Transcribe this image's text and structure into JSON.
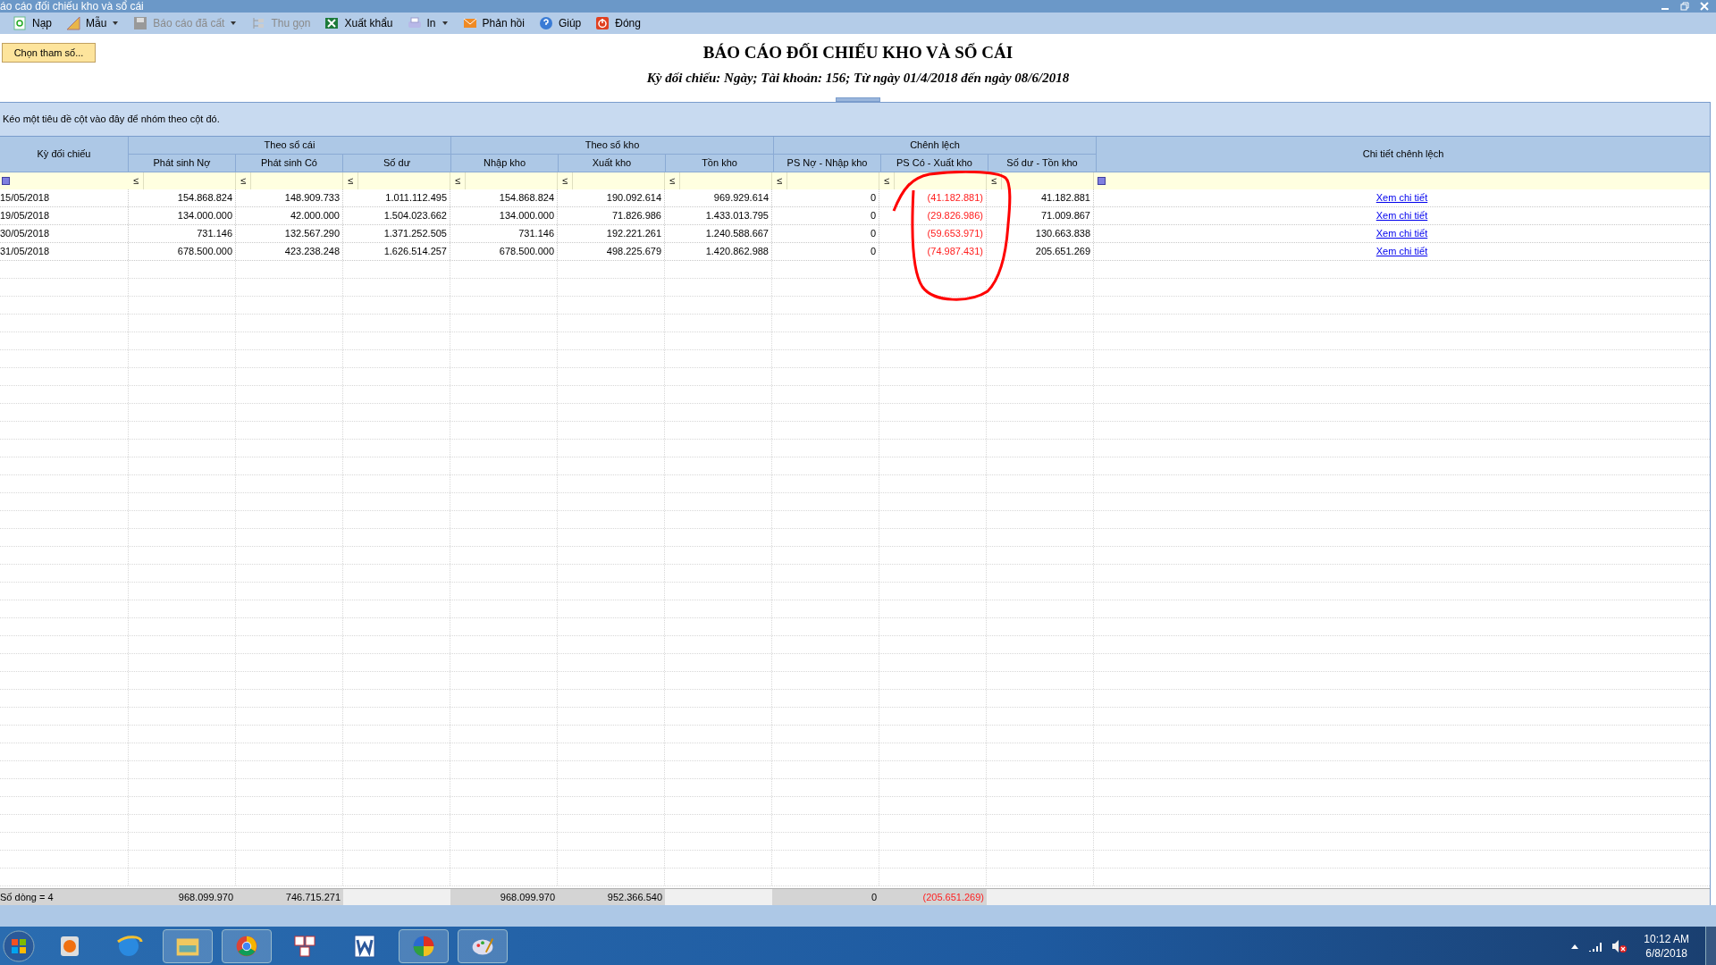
{
  "window": {
    "title": "áo cáo đối chiếu kho và sổ cái"
  },
  "toolbar": [
    {
      "label": "Nạp",
      "disabled": false,
      "dropdown": false
    },
    {
      "label": "Mẫu",
      "disabled": false,
      "dropdown": true
    },
    {
      "label": "Báo cáo đã cất",
      "disabled": true,
      "dropdown": true
    },
    {
      "label": "Thu gọn",
      "disabled": true,
      "dropdown": false
    },
    {
      "label": "Xuất khẩu",
      "disabled": false,
      "dropdown": false
    },
    {
      "label": "In",
      "disabled": false,
      "dropdown": true
    },
    {
      "label": "Phản hồi",
      "disabled": false,
      "dropdown": false
    },
    {
      "label": "Giúp",
      "disabled": false,
      "dropdown": false
    },
    {
      "label": "Đóng",
      "disabled": false,
      "dropdown": false
    }
  ],
  "parameter_button": "Chọn tham số...",
  "report": {
    "title": "BÁO CÁO ĐỐI CHIẾU KHO VÀ SỔ CÁI",
    "subtitle": "Kỳ đối chiếu: Ngày; Tài khoản: 156; Từ ngày 01/4/2018 đến ngày 08/6/2018"
  },
  "group_panel_hint": "Kéo một tiêu đề cột vào đây để nhóm theo cột đó.",
  "grid": {
    "first_column": "Kỳ đối chiếu",
    "groups": [
      {
        "label": "Theo sổ cái",
        "columns": [
          {
            "label": "Phát sinh Nợ",
            "negative": false,
            "total": "968.099.970"
          },
          {
            "label": "Phát sinh Có",
            "negative": false,
            "total": "746.715.271"
          },
          {
            "label": "Số dư",
            "negative": false
          }
        ]
      },
      {
        "label": "Theo sổ kho",
        "columns": [
          {
            "label": "Nhập kho",
            "negative": false,
            "total": "968.099.970"
          },
          {
            "label": "Xuất kho",
            "negative": false,
            "total": "952.366.540"
          },
          {
            "label": "Tồn kho",
            "negative": false
          }
        ]
      },
      {
        "label": "Chênh lệch",
        "columns": [
          {
            "label": "PS Nợ - Nhập kho",
            "negative": false,
            "total": "0"
          },
          {
            "label": "PS Có - Xuất kho",
            "negative": true,
            "total": "(205.651.269)"
          },
          {
            "label": "Số dư - Tồn kho",
            "negative": false
          }
        ]
      }
    ],
    "last_column": "Chi tiết chênh lệch",
    "filter_operator": "≤",
    "rows": [
      {
        "period": "15/05/2018",
        "values": [
          "154.868.824",
          "148.909.733",
          "1.011.112.495",
          "154.868.824",
          "190.092.614",
          "969.929.614",
          "0",
          "(41.182.881)",
          "41.182.881"
        ],
        "link": "Xem chi tiết"
      },
      {
        "period": "19/05/2018",
        "values": [
          "134.000.000",
          "42.000.000",
          "1.504.023.662",
          "134.000.000",
          "71.826.986",
          "1.433.013.795",
          "0",
          "(29.826.986)",
          "71.009.867"
        ],
        "link": "Xem chi tiết"
      },
      {
        "period": "30/05/2018",
        "values": [
          "731.146",
          "132.567.290",
          "1.371.252.505",
          "731.146",
          "192.221.261",
          "1.240.588.667",
          "0",
          "(59.653.971)",
          "130.663.838"
        ],
        "link": "Xem chi tiết"
      },
      {
        "period": "31/05/2018",
        "values": [
          "678.500.000",
          "423.238.248",
          "1.626.514.257",
          "678.500.000",
          "498.225.679",
          "1.420.862.988",
          "0",
          "(74.987.431)",
          "205.651.269"
        ],
        "link": "Xem chi tiết"
      }
    ],
    "footer": {
      "count": "Số dòng = 4"
    }
  },
  "taskbar": {
    "time": "10:12 AM",
    "date": "6/8/2018"
  }
}
